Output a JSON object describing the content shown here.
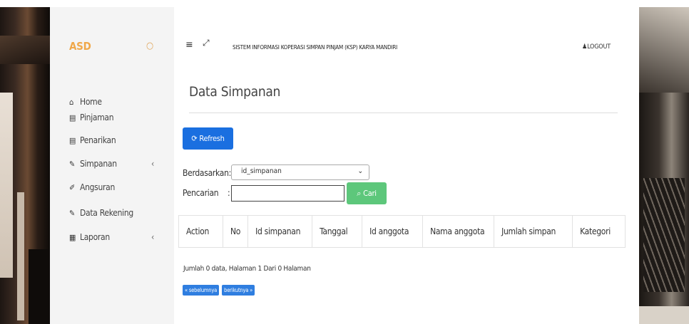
{
  "sidebar": {
    "brand": "ASD",
    "toggle_icon": "circle-toggle-icon",
    "items": [
      {
        "label": "Home",
        "icon": "home-icon",
        "has_submenu": false
      },
      {
        "label": "Pinjaman",
        "icon": "credit-card-icon",
        "has_submenu": false
      },
      {
        "label": "Penarikan",
        "icon": "credit-card-icon",
        "has_submenu": false
      },
      {
        "label": "Simpanan",
        "icon": "edit-icon",
        "has_submenu": true
      },
      {
        "label": "Angsuran",
        "icon": "pencil-icon",
        "has_submenu": false
      },
      {
        "label": "Data Rekening",
        "icon": "edit-icon",
        "has_submenu": false
      },
      {
        "label": "Laporan",
        "icon": "calendar-icon",
        "has_submenu": true
      }
    ]
  },
  "header": {
    "app_title": "SISTEM INFORMASI KOPERASI SIMPAN PINJAM (KSP) KARYA MANDIRI",
    "logout_label": "LOGOUT"
  },
  "main": {
    "page_title": "Data Simpanan",
    "refresh_label": "Refresh",
    "filter": {
      "by_label": "Berdasarkan:",
      "by_value": "id_simpanan",
      "search_label": "Pencarian",
      "search_colon": ":",
      "search_value": "",
      "search_button": "Cari"
    },
    "table": {
      "columns": [
        "Action",
        "No",
        "Id simpanan",
        "Tanggal",
        "Id anggota",
        "Nama anggota",
        "Jumlah simpan",
        "Kategori"
      ],
      "rows": []
    },
    "summary": "Jumlah 0 data, Halaman 1 Dari 0 Halaman",
    "pager": {
      "prev_label": "« sebelumnya",
      "next_label": "berikutnya »"
    }
  },
  "colors": {
    "brand": "#f0a84a",
    "primary_button": "#1a6fe0",
    "search_button": "#5dc77b",
    "pager_button": "#2f7ee0"
  }
}
